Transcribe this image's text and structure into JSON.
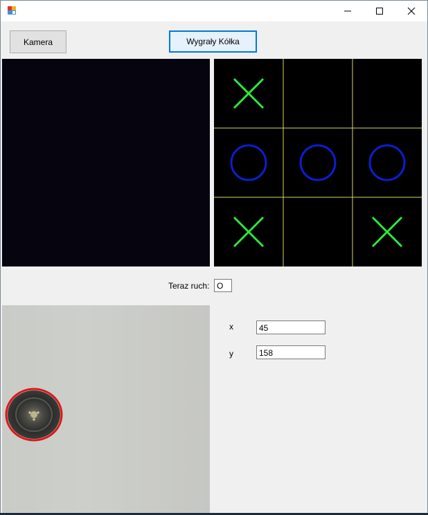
{
  "window": {
    "title": "",
    "controls": {
      "minimize_icon": "minimize-icon",
      "maximize_icon": "maximize-icon",
      "close_icon": "close-icon"
    }
  },
  "toolbar": {
    "camera_button": "Kamera",
    "result_button": "Wygrały Kółka"
  },
  "board": {
    "cells": [
      "X",
      "",
      "",
      "O",
      "O",
      "O",
      "X",
      "",
      "X"
    ],
    "colors": {
      "x": "#2bea3a",
      "o": "#0a1fd0",
      "grid": "#d8d46a",
      "background": "#000000"
    }
  },
  "turn": {
    "label": "Teraz ruch:",
    "value": "O"
  },
  "coords": {
    "x_label": "x",
    "x_value": "45",
    "y_label": "y",
    "y_value": "158"
  },
  "detection": {
    "circle_color": "#e01515"
  }
}
